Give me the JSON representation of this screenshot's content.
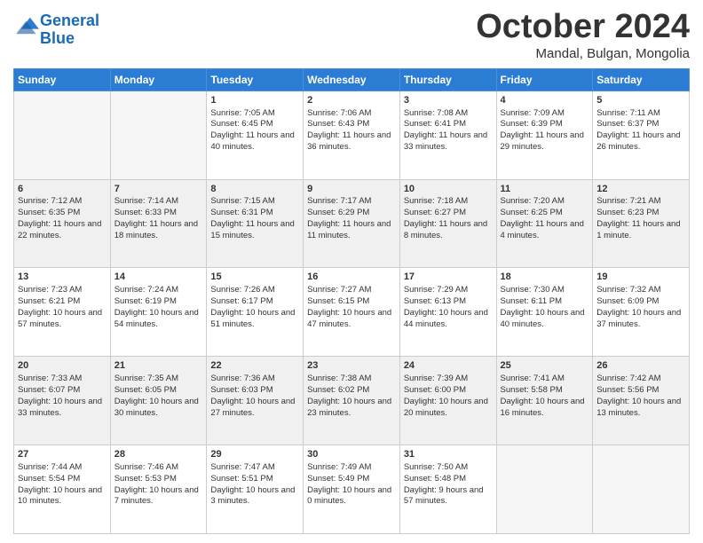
{
  "logo": {
    "line1": "General",
    "line2": "Blue"
  },
  "title": "October 2024",
  "location": "Mandal, Bulgan, Mongolia",
  "days_of_week": [
    "Sunday",
    "Monday",
    "Tuesday",
    "Wednesday",
    "Thursday",
    "Friday",
    "Saturday"
  ],
  "weeks": [
    [
      {
        "day": "",
        "sunrise": "",
        "sunset": "",
        "daylight": "",
        "empty": true
      },
      {
        "day": "",
        "sunrise": "",
        "sunset": "",
        "daylight": "",
        "empty": true
      },
      {
        "day": "1",
        "sunrise": "Sunrise: 7:05 AM",
        "sunset": "Sunset: 6:45 PM",
        "daylight": "Daylight: 11 hours and 40 minutes.",
        "empty": false
      },
      {
        "day": "2",
        "sunrise": "Sunrise: 7:06 AM",
        "sunset": "Sunset: 6:43 PM",
        "daylight": "Daylight: 11 hours and 36 minutes.",
        "empty": false
      },
      {
        "day": "3",
        "sunrise": "Sunrise: 7:08 AM",
        "sunset": "Sunset: 6:41 PM",
        "daylight": "Daylight: 11 hours and 33 minutes.",
        "empty": false
      },
      {
        "day": "4",
        "sunrise": "Sunrise: 7:09 AM",
        "sunset": "Sunset: 6:39 PM",
        "daylight": "Daylight: 11 hours and 29 minutes.",
        "empty": false
      },
      {
        "day": "5",
        "sunrise": "Sunrise: 7:11 AM",
        "sunset": "Sunset: 6:37 PM",
        "daylight": "Daylight: 11 hours and 26 minutes.",
        "empty": false
      }
    ],
    [
      {
        "day": "6",
        "sunrise": "Sunrise: 7:12 AM",
        "sunset": "Sunset: 6:35 PM",
        "daylight": "Daylight: 11 hours and 22 minutes.",
        "empty": false
      },
      {
        "day": "7",
        "sunrise": "Sunrise: 7:14 AM",
        "sunset": "Sunset: 6:33 PM",
        "daylight": "Daylight: 11 hours and 18 minutes.",
        "empty": false
      },
      {
        "day": "8",
        "sunrise": "Sunrise: 7:15 AM",
        "sunset": "Sunset: 6:31 PM",
        "daylight": "Daylight: 11 hours and 15 minutes.",
        "empty": false
      },
      {
        "day": "9",
        "sunrise": "Sunrise: 7:17 AM",
        "sunset": "Sunset: 6:29 PM",
        "daylight": "Daylight: 11 hours and 11 minutes.",
        "empty": false
      },
      {
        "day": "10",
        "sunrise": "Sunrise: 7:18 AM",
        "sunset": "Sunset: 6:27 PM",
        "daylight": "Daylight: 11 hours and 8 minutes.",
        "empty": false
      },
      {
        "day": "11",
        "sunrise": "Sunrise: 7:20 AM",
        "sunset": "Sunset: 6:25 PM",
        "daylight": "Daylight: 11 hours and 4 minutes.",
        "empty": false
      },
      {
        "day": "12",
        "sunrise": "Sunrise: 7:21 AM",
        "sunset": "Sunset: 6:23 PM",
        "daylight": "Daylight: 11 hours and 1 minute.",
        "empty": false
      }
    ],
    [
      {
        "day": "13",
        "sunrise": "Sunrise: 7:23 AM",
        "sunset": "Sunset: 6:21 PM",
        "daylight": "Daylight: 10 hours and 57 minutes.",
        "empty": false
      },
      {
        "day": "14",
        "sunrise": "Sunrise: 7:24 AM",
        "sunset": "Sunset: 6:19 PM",
        "daylight": "Daylight: 10 hours and 54 minutes.",
        "empty": false
      },
      {
        "day": "15",
        "sunrise": "Sunrise: 7:26 AM",
        "sunset": "Sunset: 6:17 PM",
        "daylight": "Daylight: 10 hours and 51 minutes.",
        "empty": false
      },
      {
        "day": "16",
        "sunrise": "Sunrise: 7:27 AM",
        "sunset": "Sunset: 6:15 PM",
        "daylight": "Daylight: 10 hours and 47 minutes.",
        "empty": false
      },
      {
        "day": "17",
        "sunrise": "Sunrise: 7:29 AM",
        "sunset": "Sunset: 6:13 PM",
        "daylight": "Daylight: 10 hours and 44 minutes.",
        "empty": false
      },
      {
        "day": "18",
        "sunrise": "Sunrise: 7:30 AM",
        "sunset": "Sunset: 6:11 PM",
        "daylight": "Daylight: 10 hours and 40 minutes.",
        "empty": false
      },
      {
        "day": "19",
        "sunrise": "Sunrise: 7:32 AM",
        "sunset": "Sunset: 6:09 PM",
        "daylight": "Daylight: 10 hours and 37 minutes.",
        "empty": false
      }
    ],
    [
      {
        "day": "20",
        "sunrise": "Sunrise: 7:33 AM",
        "sunset": "Sunset: 6:07 PM",
        "daylight": "Daylight: 10 hours and 33 minutes.",
        "empty": false
      },
      {
        "day": "21",
        "sunrise": "Sunrise: 7:35 AM",
        "sunset": "Sunset: 6:05 PM",
        "daylight": "Daylight: 10 hours and 30 minutes.",
        "empty": false
      },
      {
        "day": "22",
        "sunrise": "Sunrise: 7:36 AM",
        "sunset": "Sunset: 6:03 PM",
        "daylight": "Daylight: 10 hours and 27 minutes.",
        "empty": false
      },
      {
        "day": "23",
        "sunrise": "Sunrise: 7:38 AM",
        "sunset": "Sunset: 6:02 PM",
        "daylight": "Daylight: 10 hours and 23 minutes.",
        "empty": false
      },
      {
        "day": "24",
        "sunrise": "Sunrise: 7:39 AM",
        "sunset": "Sunset: 6:00 PM",
        "daylight": "Daylight: 10 hours and 20 minutes.",
        "empty": false
      },
      {
        "day": "25",
        "sunrise": "Sunrise: 7:41 AM",
        "sunset": "Sunset: 5:58 PM",
        "daylight": "Daylight: 10 hours and 16 minutes.",
        "empty": false
      },
      {
        "day": "26",
        "sunrise": "Sunrise: 7:42 AM",
        "sunset": "Sunset: 5:56 PM",
        "daylight": "Daylight: 10 hours and 13 minutes.",
        "empty": false
      }
    ],
    [
      {
        "day": "27",
        "sunrise": "Sunrise: 7:44 AM",
        "sunset": "Sunset: 5:54 PM",
        "daylight": "Daylight: 10 hours and 10 minutes.",
        "empty": false
      },
      {
        "day": "28",
        "sunrise": "Sunrise: 7:46 AM",
        "sunset": "Sunset: 5:53 PM",
        "daylight": "Daylight: 10 hours and 7 minutes.",
        "empty": false
      },
      {
        "day": "29",
        "sunrise": "Sunrise: 7:47 AM",
        "sunset": "Sunset: 5:51 PM",
        "daylight": "Daylight: 10 hours and 3 minutes.",
        "empty": false
      },
      {
        "day": "30",
        "sunrise": "Sunrise: 7:49 AM",
        "sunset": "Sunset: 5:49 PM",
        "daylight": "Daylight: 10 hours and 0 minutes.",
        "empty": false
      },
      {
        "day": "31",
        "sunrise": "Sunrise: 7:50 AM",
        "sunset": "Sunset: 5:48 PM",
        "daylight": "Daylight: 9 hours and 57 minutes.",
        "empty": false
      },
      {
        "day": "",
        "sunrise": "",
        "sunset": "",
        "daylight": "",
        "empty": true
      },
      {
        "day": "",
        "sunrise": "",
        "sunset": "",
        "daylight": "",
        "empty": true
      }
    ]
  ]
}
